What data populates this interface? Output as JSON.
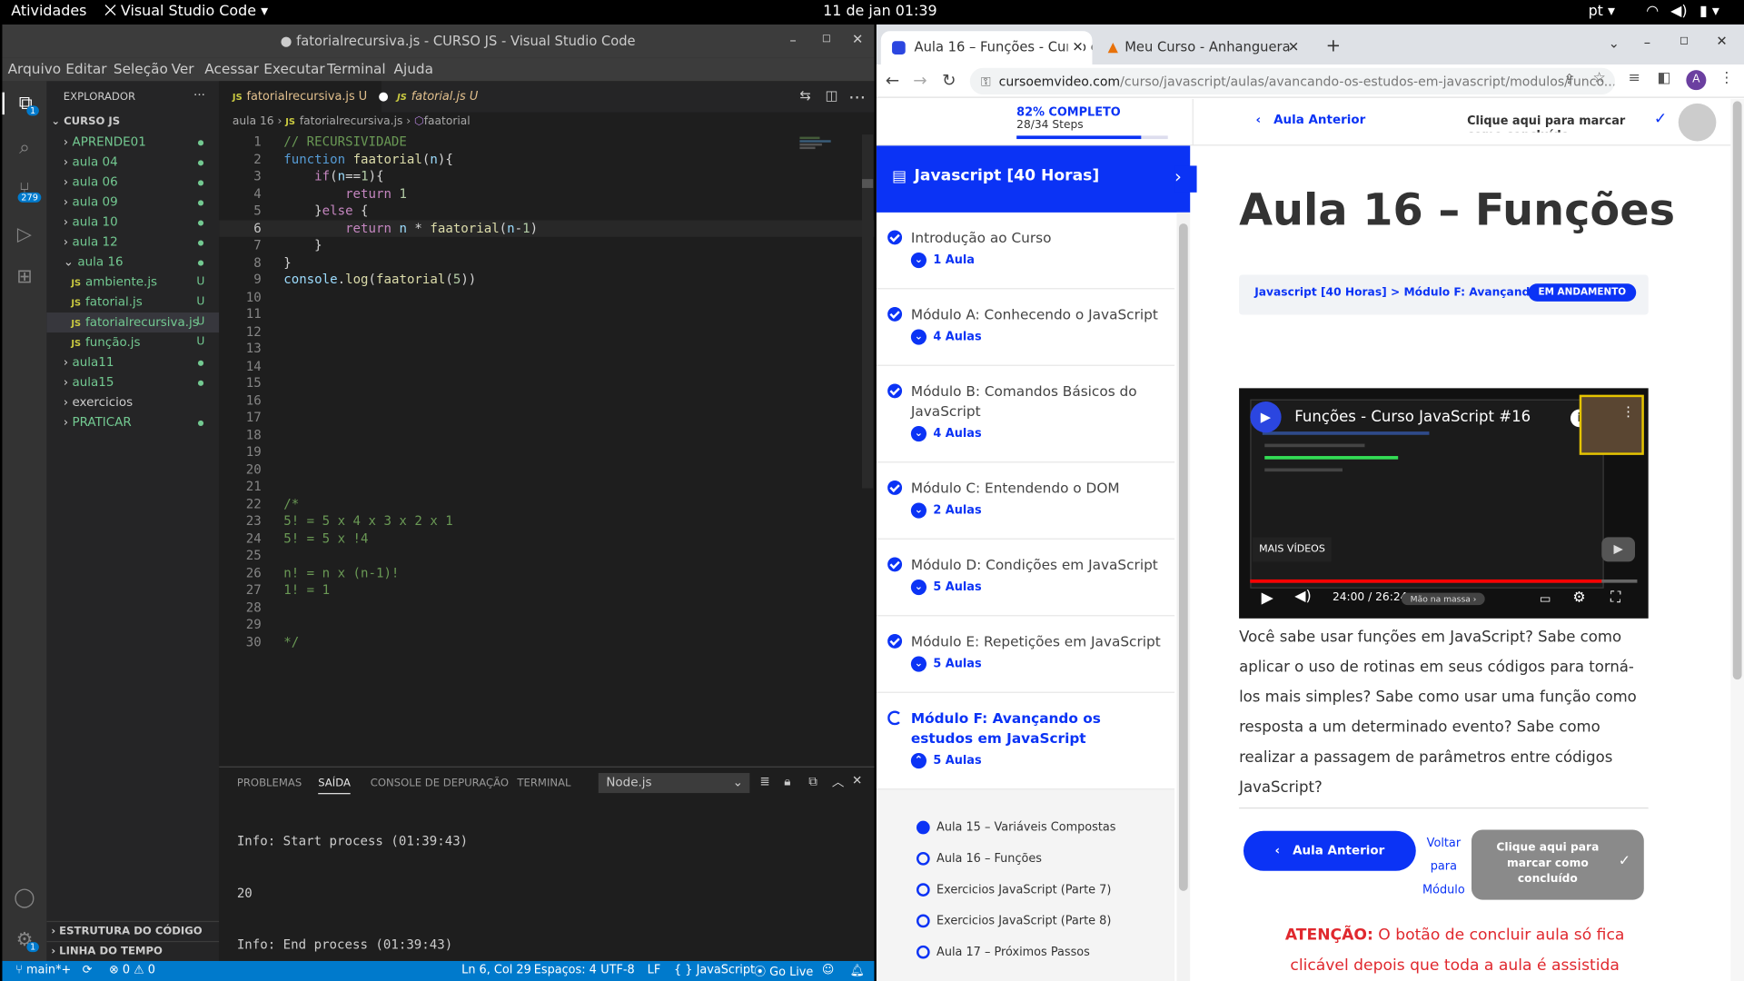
{
  "os": {
    "activities": "Atividades",
    "app": "Visual Studio Code",
    "clock": "11 de jan  01:39",
    "lang": "pt"
  },
  "vscode": {
    "title": "● fatorialrecursiva.js - CURSO JS - Visual Studio Code",
    "menu": [
      "Arquivo",
      "Editar",
      "Seleção",
      "Ver",
      "Acessar",
      "Executar",
      "Terminal",
      "Ajuda"
    ],
    "explorer_title": "EXPLORADOR",
    "workspace": "CURSO JS",
    "tree": [
      {
        "label": "APRENDE01",
        "kind": "folder",
        "badge": "dot"
      },
      {
        "label": "aula 04",
        "kind": "folder",
        "badge": "dot"
      },
      {
        "label": "aula 06",
        "kind": "folder",
        "badge": "dot"
      },
      {
        "label": "aula 09",
        "kind": "folder",
        "badge": "dot"
      },
      {
        "label": "aula 10",
        "kind": "folder",
        "badge": "dot"
      },
      {
        "label": "aula 12",
        "kind": "folder",
        "badge": "dot"
      },
      {
        "label": "aula 16",
        "kind": "folder-open",
        "badge": "dot"
      },
      {
        "label": "ambiente.js",
        "kind": "file",
        "badge": "U"
      },
      {
        "label": "fatorial.js",
        "kind": "file",
        "badge": "U"
      },
      {
        "label": "fatorialrecursiva.js",
        "kind": "file-active",
        "badge": "U"
      },
      {
        "label": "função.js",
        "kind": "file",
        "badge": "U"
      },
      {
        "label": "aula11",
        "kind": "folder",
        "badge": "dot"
      },
      {
        "label": "aula15",
        "kind": "folder",
        "badge": "dot"
      },
      {
        "label": "exercicios",
        "kind": "folder",
        "badge": ""
      },
      {
        "label": "PRATICAR",
        "kind": "folder",
        "badge": "dot"
      }
    ],
    "outline": "ESTRUTURA DO CÓDIGO",
    "timeline": "LINHA DO TEMPO",
    "tabs": [
      {
        "label": "fatorialrecursiva.js",
        "flag": "U"
      },
      {
        "label": "fatorial.js",
        "flag": "U"
      }
    ],
    "breadcrumb": [
      "aula 16",
      "fatorialrecursiva.js",
      "faatorial"
    ],
    "lines": [
      "// RECURSIVIDADE",
      "function faatorial(n){",
      "    if(n==1){",
      "        return 1",
      "    }else {",
      "        return n * faatorial(n-1)",
      "    }",
      "}",
      "console.log(faatorial(5))",
      "",
      "",
      "",
      "",
      "",
      "",
      "",
      "",
      "",
      "",
      "",
      "",
      "/*",
      "5! = 5 x 4 x 3 x 2 x 1",
      "5! = 5 x !4",
      "",
      "n! = n x (n-1)!",
      "1! = 1",
      "",
      "",
      "*/"
    ],
    "panel_tabs": [
      "PROBLEMAS",
      "SAÍDA",
      "CONSOLE DE DEPURAÇÃO",
      "TERMINAL"
    ],
    "panel_select": "Node.js",
    "output": [
      "Info: Start process (01:39:43)",
      "20",
      "Info: End process (01:39:43)"
    ],
    "activity_badges": {
      "explorer": "1",
      "scm": "279",
      "settings": "1"
    },
    "status": {
      "branch": "main*+",
      "problems": "⊗ 0 ⚠ 0",
      "pos": "Ln 6, Col 29",
      "spaces": "Espaços: 4",
      "enc": "UTF-8",
      "eol": "LF",
      "lang": "{ } JavaScript",
      "golive": "Go Live"
    }
  },
  "chrome": {
    "tabs": [
      {
        "label": "Aula 16 – Funções - Curso e",
        "active": true
      },
      {
        "label": "Meu Curso - Anhanguera",
        "active": false
      }
    ],
    "url_host": "cursoemvideo.com",
    "url_path": "/curso/javascript/aulas/avancando-os-estudos-em-javascript/modulos/funco...",
    "profile": "A"
  },
  "course": {
    "progress_label": "82% COMPLETO",
    "steps": "28/34 Steps",
    "progress": 0.82,
    "prev_link": "Aula Anterior",
    "mark_complete_top": "Clique aqui para marcar como concluído",
    "course_title": "Javascript [40 Horas]",
    "modules": [
      {
        "title": "Introdução ao Curso",
        "count": "1 Aula"
      },
      {
        "title": "Módulo A: Conhecendo o JavaScript",
        "count": "4 Aulas"
      },
      {
        "title": "Módulo B: Comandos Básicos do JavaScript",
        "count": "4 Aulas"
      },
      {
        "title": "Módulo C: Entendendo o DOM",
        "count": "2 Aulas"
      },
      {
        "title": "Módulo D: Condições em JavaScript",
        "count": "5 Aulas"
      },
      {
        "title": "Módulo E: Repetições em JavaScript",
        "count": "5 Aulas"
      },
      {
        "title": "Módulo F: Avançando os estudos em JavaScript",
        "count": "5 Aulas"
      }
    ],
    "lessons": [
      {
        "title": "Aula 15 – Variáveis Compostas",
        "done": true
      },
      {
        "title": "Aula 16 – Funções",
        "done": false
      },
      {
        "title": "Exercicios JavaScript (Parte 7)",
        "done": false
      },
      {
        "title": "Exercicios JavaScript (Parte 8)",
        "done": false
      },
      {
        "title": "Aula 17 – Próximos Passos",
        "done": false
      }
    ],
    "heading": "Aula 16 – Funções",
    "crumb": "Javascript [40 Horas] > Módulo F: Avançando o...",
    "status_badge": "EM ANDAMENTO",
    "video": {
      "title": "Funções - Curso JavaScript #16",
      "more": "MAIS VÍDEOS",
      "time": "24:00 / 26:24",
      "chapter": "Mão na massa",
      "watched": 0.909
    },
    "description": "Você sabe usar funções em JavaScript? Sabe como aplicar o uso de rotinas em seus códigos para torná-los mais simples? Sabe como usar uma função como resposta a um determinado evento? Sabe como realizar a passagem de parâmetros entre códigos JavaScript?",
    "btn_prev": "Aula Anterior",
    "btn_back": "Voltar para Módulo",
    "btn_complete": "Clique aqui para marcar como concluído",
    "warning_strong": "ATENÇÃO:",
    "warning": " O botão de concluir aula só fica clicável depois que toda a aula é assistida"
  }
}
